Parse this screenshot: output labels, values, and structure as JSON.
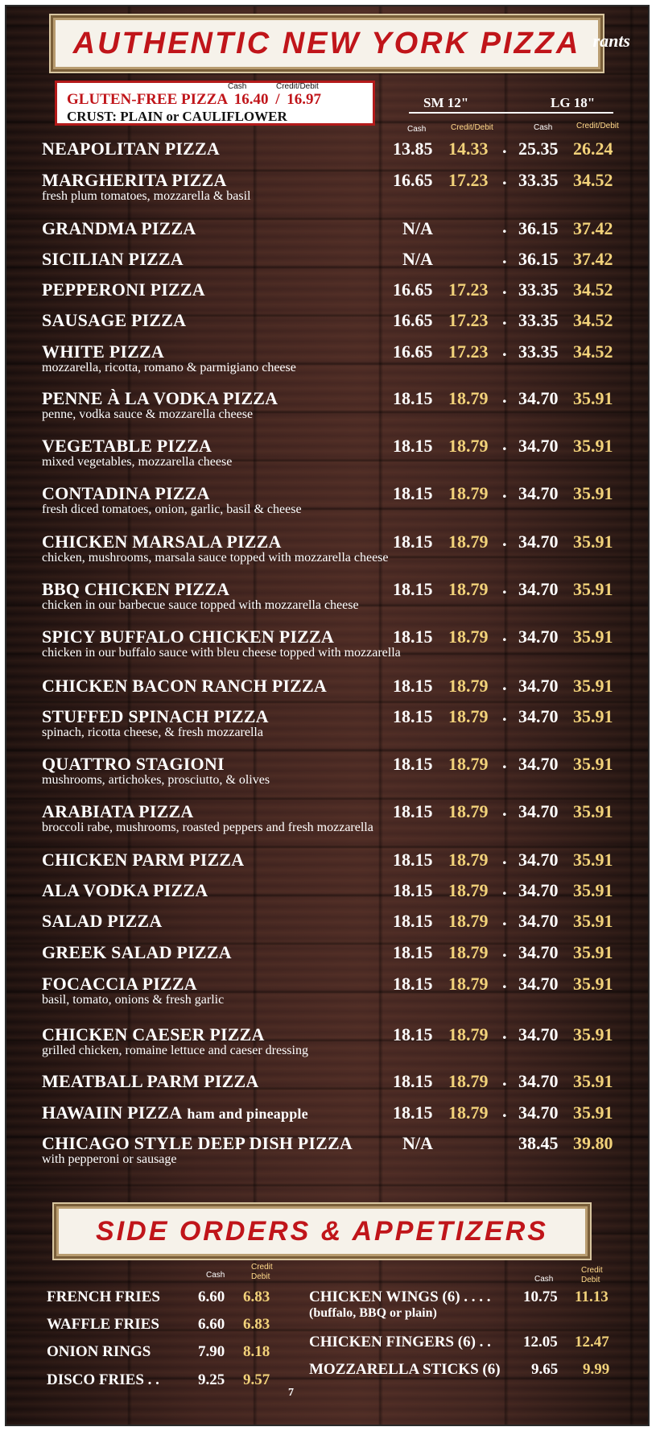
{
  "header": {
    "title": "AUTHENTIC NEW YORK PIZZA",
    "watermark": "rants"
  },
  "gluten_free": {
    "cash_label": "Cash",
    "credit_label": "Credit/Debit",
    "name": "GLUTEN-FREE PIZZA",
    "cash_price": "16.40",
    "separator": "/",
    "credit_price": "16.97",
    "crust": "CRUST: PLAIN or CAULIFLOWER"
  },
  "columns": {
    "small": "SM 12\"",
    "large": "LG 18\"",
    "cash": "Cash",
    "credit": "Credit/Debit"
  },
  "pizzas": [
    {
      "name": "NEAPOLITAN PIZZA",
      "desc": "",
      "sm_cash": "13.85",
      "sm_cc": "14.33",
      "lg_cash": "25.35",
      "lg_cc": "26.24"
    },
    {
      "name": "MARGHERITA PIZZA",
      "desc": "fresh plum tomatoes, mozzarella & basil",
      "sm_cash": "16.65",
      "sm_cc": "17.23",
      "lg_cash": "33.35",
      "lg_cc": "34.52"
    },
    {
      "name": "GRANDMA PIZZA",
      "desc": "",
      "sm_cash": "N/A",
      "sm_cc": "",
      "lg_cash": "36.15",
      "lg_cc": "37.42"
    },
    {
      "name": "SICILIAN PIZZA",
      "desc": "",
      "sm_cash": "N/A",
      "sm_cc": "",
      "lg_cash": "36.15",
      "lg_cc": "37.42"
    },
    {
      "name": "PEPPERONI PIZZA",
      "desc": "",
      "sm_cash": "16.65",
      "sm_cc": "17.23",
      "lg_cash": "33.35",
      "lg_cc": "34.52"
    },
    {
      "name": "SAUSAGE PIZZA",
      "desc": "",
      "sm_cash": "16.65",
      "sm_cc": "17.23",
      "lg_cash": "33.35",
      "lg_cc": "34.52"
    },
    {
      "name": "WHITE PIZZA",
      "desc": "mozzarella, ricotta, romano & parmigiano cheese",
      "sm_cash": "16.65",
      "sm_cc": "17.23",
      "lg_cash": "33.35",
      "lg_cc": "34.52"
    },
    {
      "name": "PENNE À LA VODKA PIZZA",
      "desc": "penne, vodka sauce & mozzarella cheese",
      "sm_cash": "18.15",
      "sm_cc": "18.79",
      "lg_cash": "34.70",
      "lg_cc": "35.91"
    },
    {
      "name": "VEGETABLE PIZZA",
      "desc": "mixed vegetables, mozzarella cheese",
      "sm_cash": "18.15",
      "sm_cc": "18.79",
      "lg_cash": "34.70",
      "lg_cc": "35.91"
    },
    {
      "name": "CONTADINA PIZZA",
      "desc": "fresh diced tomatoes, onion, garlic, basil & cheese",
      "sm_cash": "18.15",
      "sm_cc": "18.79",
      "lg_cash": "34.70",
      "lg_cc": "35.91"
    },
    {
      "name": "CHICKEN MARSALA PIZZA",
      "desc": "chicken, mushrooms, marsala sauce topped with mozzarella cheese",
      "sm_cash": "18.15",
      "sm_cc": "18.79",
      "lg_cash": "34.70",
      "lg_cc": "35.91"
    },
    {
      "name": "BBQ CHICKEN PIZZA",
      "desc": "chicken in our barbecue sauce topped with mozzarella cheese",
      "sm_cash": "18.15",
      "sm_cc": "18.79",
      "lg_cash": "34.70",
      "lg_cc": "35.91"
    },
    {
      "name": "SPICY BUFFALO CHICKEN PIZZA",
      "desc": "chicken in our buffalo sauce with bleu cheese topped with mozzarella",
      "sm_cash": "18.15",
      "sm_cc": "18.79",
      "lg_cash": "34.70",
      "lg_cc": "35.91"
    },
    {
      "name": "CHICKEN BACON RANCH PIZZA",
      "desc": "",
      "sm_cash": "18.15",
      "sm_cc": "18.79",
      "lg_cash": "34.70",
      "lg_cc": "35.91"
    },
    {
      "name": "STUFFED SPINACH PIZZA",
      "desc": "spinach, ricotta cheese, & fresh mozzarella",
      "sm_cash": "18.15",
      "sm_cc": "18.79",
      "lg_cash": "34.70",
      "lg_cc": "35.91"
    },
    {
      "name": "QUATTRO STAGIONI",
      "desc": "mushrooms, artichokes, prosciutto, & olives",
      "sm_cash": "18.15",
      "sm_cc": "18.79",
      "lg_cash": "34.70",
      "lg_cc": "35.91"
    },
    {
      "name": "ARABIATA PIZZA",
      "desc": "broccoli rabe, mushrooms, roasted peppers and fresh mozzarella",
      "sm_cash": "18.15",
      "sm_cc": "18.79",
      "lg_cash": "34.70",
      "lg_cc": "35.91"
    },
    {
      "name": "CHICKEN PARM PIZZA",
      "desc": "",
      "sm_cash": "18.15",
      "sm_cc": "18.79",
      "lg_cash": "34.70",
      "lg_cc": "35.91"
    },
    {
      "name": "ALA VODKA PIZZA",
      "desc": "",
      "sm_cash": "18.15",
      "sm_cc": "18.79",
      "lg_cash": "34.70",
      "lg_cc": "35.91"
    },
    {
      "name": "SALAD PIZZA",
      "desc": "",
      "sm_cash": "18.15",
      "sm_cc": "18.79",
      "lg_cash": "34.70",
      "lg_cc": "35.91"
    },
    {
      "name": "GREEK SALAD PIZZA",
      "desc": "",
      "sm_cash": "18.15",
      "sm_cc": "18.79",
      "lg_cash": "34.70",
      "lg_cc": "35.91"
    },
    {
      "name": "FOCACCIA PIZZA",
      "desc": "basil, tomato, onions & fresh garlic",
      "sm_cash": "18.15",
      "sm_cc": "18.79",
      "lg_cash": "34.70",
      "lg_cc": "35.91"
    },
    {
      "name": "CHICKEN CAESER PIZZA",
      "desc": "grilled chicken, romaine lettuce and caeser dressing",
      "sm_cash": "18.15",
      "sm_cc": "18.79",
      "lg_cash": "34.70",
      "lg_cc": "35.91"
    },
    {
      "name": "MEATBALL PARM PIZZA",
      "desc": "",
      "sm_cash": "18.15",
      "sm_cc": "18.79",
      "lg_cash": "34.70",
      "lg_cc": "35.91"
    },
    {
      "name": "HAWAIIN PIZZA",
      "extra": "ham and pineapple",
      "desc": "",
      "sm_cash": "18.15",
      "sm_cc": "18.79",
      "lg_cash": "34.70",
      "lg_cc": "35.91"
    },
    {
      "name": "CHICAGO STYLE DEEP DISH PIZZA",
      "desc": "with pepperoni or sausage",
      "sm_cash": "N/A",
      "sm_cc": "",
      "lg_cash": "38.45",
      "lg_cc": "39.80"
    }
  ],
  "sides": {
    "title": "SIDE ORDERS & APPETIZERS",
    "cash_label": "Cash",
    "credit_label_1": "Credit",
    "credit_label_2": "Debit",
    "left": [
      {
        "name": "FRENCH FRIES",
        "cash": "6.60",
        "cc": "6.83"
      },
      {
        "name": "WAFFLE FRIES",
        "cash": "6.60",
        "cc": "6.83"
      },
      {
        "name": "ONION RINGS",
        "cash": "7.90",
        "cc": "8.18"
      },
      {
        "name": "DISCO FRIES  . .",
        "cash": "9.25",
        "cc": "9.57"
      }
    ],
    "right": [
      {
        "name": "CHICKEN WINGS (6) . . . .",
        "desc": "(buffalo, BBQ or plain)",
        "cash": "10.75",
        "cc": "11.13"
      },
      {
        "name": "CHICKEN FINGERS (6) . .",
        "desc": "",
        "cash": "12.05",
        "cc": "12.47"
      },
      {
        "name": "MOZZARELLA STICKS (6)",
        "desc": "",
        "cash": "9.65",
        "cc": "9.99"
      }
    ]
  },
  "page_number": "7",
  "colors": {
    "title_red": "#c0151a",
    "credit_gold": "#f2d27a",
    "text_white": "#ffffff"
  }
}
